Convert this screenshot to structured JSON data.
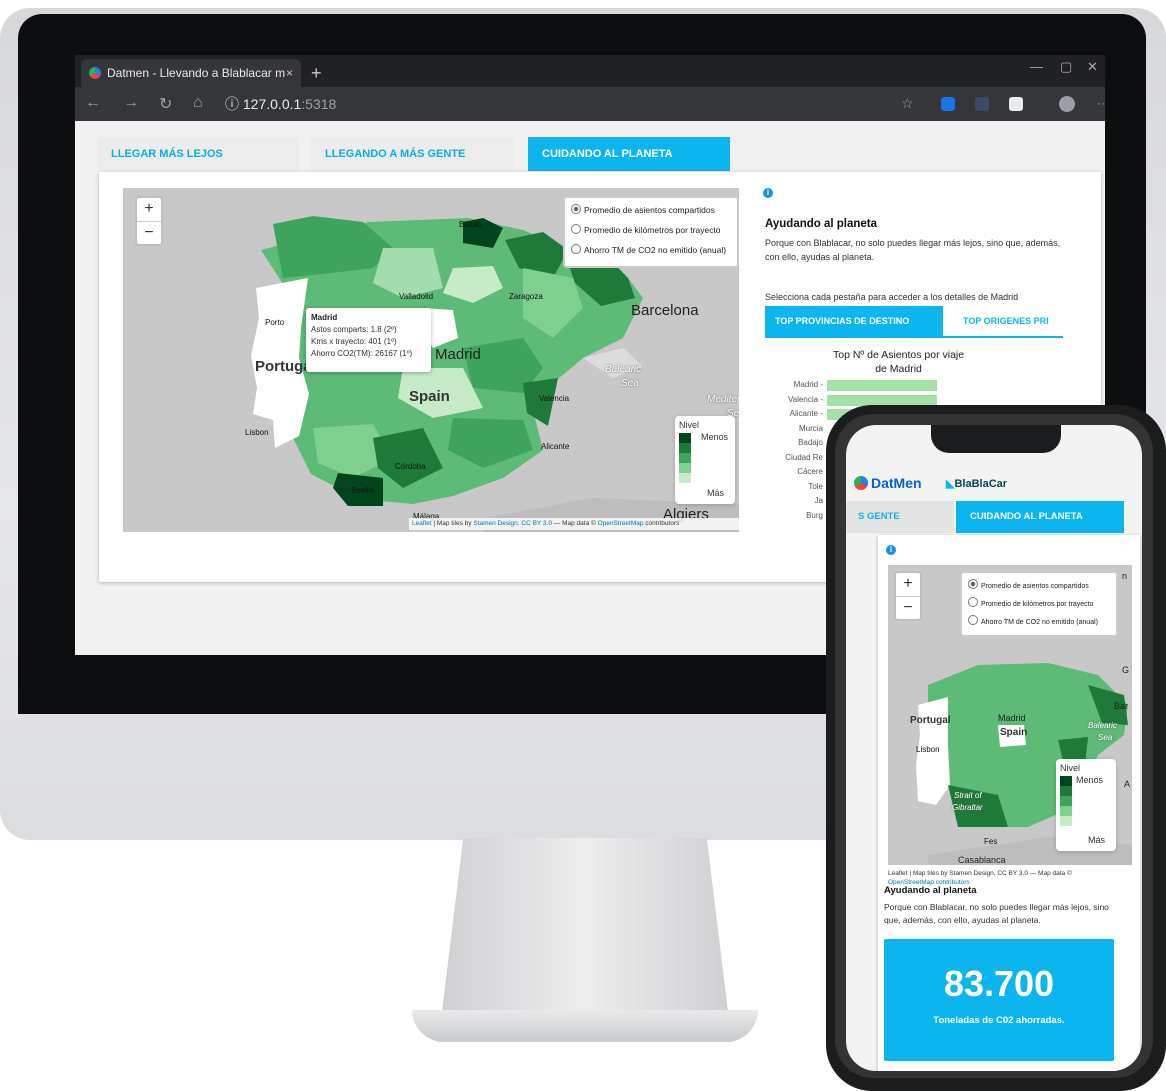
{
  "browser": {
    "tab_title": "Datmen - Llevando a Blablacar m",
    "tab_close": "×",
    "new_tab": "+",
    "minimize": "—",
    "restore": "▢",
    "close": "✕",
    "back": "←",
    "forward": "→",
    "reload": "↻",
    "home": "⌂",
    "info_icon": "ⓘ",
    "url_host": "127.0.0.1",
    "url_port": ":5318",
    "favorite": "☆",
    "more": "···"
  },
  "tabs": [
    {
      "label": "LLEGAR MÁS LEJOS",
      "active": false
    },
    {
      "label": "LLEGANDO A MÁS GENTE",
      "active": false
    },
    {
      "label": "CUIDANDO AL PLANETA",
      "active": true
    }
  ],
  "map": {
    "zoom_in": "+",
    "zoom_out": "−",
    "layers": [
      {
        "label": "Promedio de asientos compartidos",
        "selected": true
      },
      {
        "label": "Promedio de kilómetros por trayecto",
        "selected": false
      },
      {
        "label": "Ahorro TM de CO2 no emitido (anual)",
        "selected": false
      }
    ],
    "labels": {
      "bilbao": "Bilbao",
      "zaragoza": "Zaragoza",
      "valladolid": "Valladolid",
      "barcelona": "Barcelona",
      "porto": "Porto",
      "madrid": "Madrid",
      "portugal": "Portugal",
      "spain": "Spain",
      "valencia": "Valencia",
      "lisbon": "Lisbon",
      "cordoba": "Córdoba",
      "alicante": "Alicante",
      "seville": "Seville",
      "algiers": "Algiers",
      "malaga": "Málaga",
      "balearic": "Balearic",
      "sea": "Sea",
      "mediterr": "Mediterr",
      "se": "Se"
    },
    "tooltip": {
      "title": "Madrid",
      "line1": "Astos comparts: 1.8 (2º)",
      "line2": "Kms x trayecto: 401 (1º)",
      "line3": "Ahorro CO2(TM): 26167 (1º)"
    },
    "legend": {
      "title": "Nivel",
      "low": "Menos",
      "high": "Más",
      "colors": [
        "#00441b",
        "#1f7a3a",
        "#3da35d",
        "#7fcf8e",
        "#c7ebc8"
      ]
    },
    "attribution": {
      "leaflet": "Leaflet",
      "sep": " | Map tiles by ",
      "stamen": "Stamen Design, CC BY 3.0",
      "mid": " — Map data © ",
      "osm": "OpenStreetMap",
      "end": " contributors"
    }
  },
  "side": {
    "info": "i",
    "heading": "Ayudando al planeta",
    "text": "Porque con Blablacar, no solo puedes llegar más lejos, sino que, además, con ello, ayudas al planeta.",
    "select_text": "Selecciona cada pestaña para acceder a los detalles de Madrid",
    "subtabs": [
      "TOP PROVINCIAS DE DESTINO",
      "TOP ORIGENES PRI"
    ],
    "chart_title": "Top Nº de Asientos por viaje de Madrid",
    "chart_title_l1": "Top Nº de Asientos por viaje",
    "chart_title_l2": "de Madrid"
  },
  "chart_data": {
    "type": "bar",
    "title": "Top Nº de Asientos por viaje de Madrid",
    "categories": [
      "Madrid",
      "Valencia",
      "Alicante",
      "Murcia",
      "Badajoz",
      "Ciudad Real",
      "Cáceres",
      "Toledo",
      "Jaén",
      "Burgos"
    ],
    "visible_labels": [
      "Madrid -",
      "Valencia -",
      "Alicante -",
      "Murcia",
      "Badajo",
      "Ciudad Re",
      "Cácere",
      "Tole",
      "Ja",
      "Burg"
    ],
    "values": [
      1.0,
      1.0,
      1.0,
      null,
      null,
      null,
      null,
      null,
      null,
      null
    ],
    "xlabel": "",
    "ylabel": ""
  },
  "phone": {
    "brand": "DatMen",
    "partner": "BlaBlaCar",
    "tab_left": "S GENTE",
    "tab_right": "CUIDANDO AL PLANETA",
    "info": "i",
    "zoom_in": "+",
    "zoom_out": "−",
    "layers": [
      {
        "label": "Promedio de asientos compartidos",
        "selected": true
      },
      {
        "label": "Promedio de kilómetros por trayecto",
        "selected": false
      },
      {
        "label": "Ahorro TM de CO2 no emitido (anual)",
        "selected": false
      }
    ],
    "labels": {
      "portugal": "Portugal",
      "madrid": "Madrid",
      "spain": "Spain",
      "lisbon": "Lisbon",
      "balearic": "Balearic",
      "sea": "Sea",
      "strait1": "Strait of",
      "strait2": "Gibraltar",
      "fes": "Fes",
      "casablanca": "Casablanca",
      "bar": "Bar",
      "g": "G",
      "a": "A",
      "n": "n"
    },
    "legend": {
      "title": "Nivel",
      "low": "Menos",
      "high": "Más"
    },
    "attribution1": "Leaflet | Map tiles by Stamen Design, CC BY 3.0 — Map data ©",
    "attribution2": "OpenStreetMap contributors",
    "heading": "Ayudando al planeta",
    "text": "Porque con Blablacar, no solo puedes llegar más lejos, sino que, además, con ello, ayudas al planeta.",
    "stat_value": "83.700",
    "stat_label": "Toneladas de C02 ahorradas."
  },
  "colors": {
    "accent": "#0db5ef",
    "tab_text": "#09aee8"
  }
}
